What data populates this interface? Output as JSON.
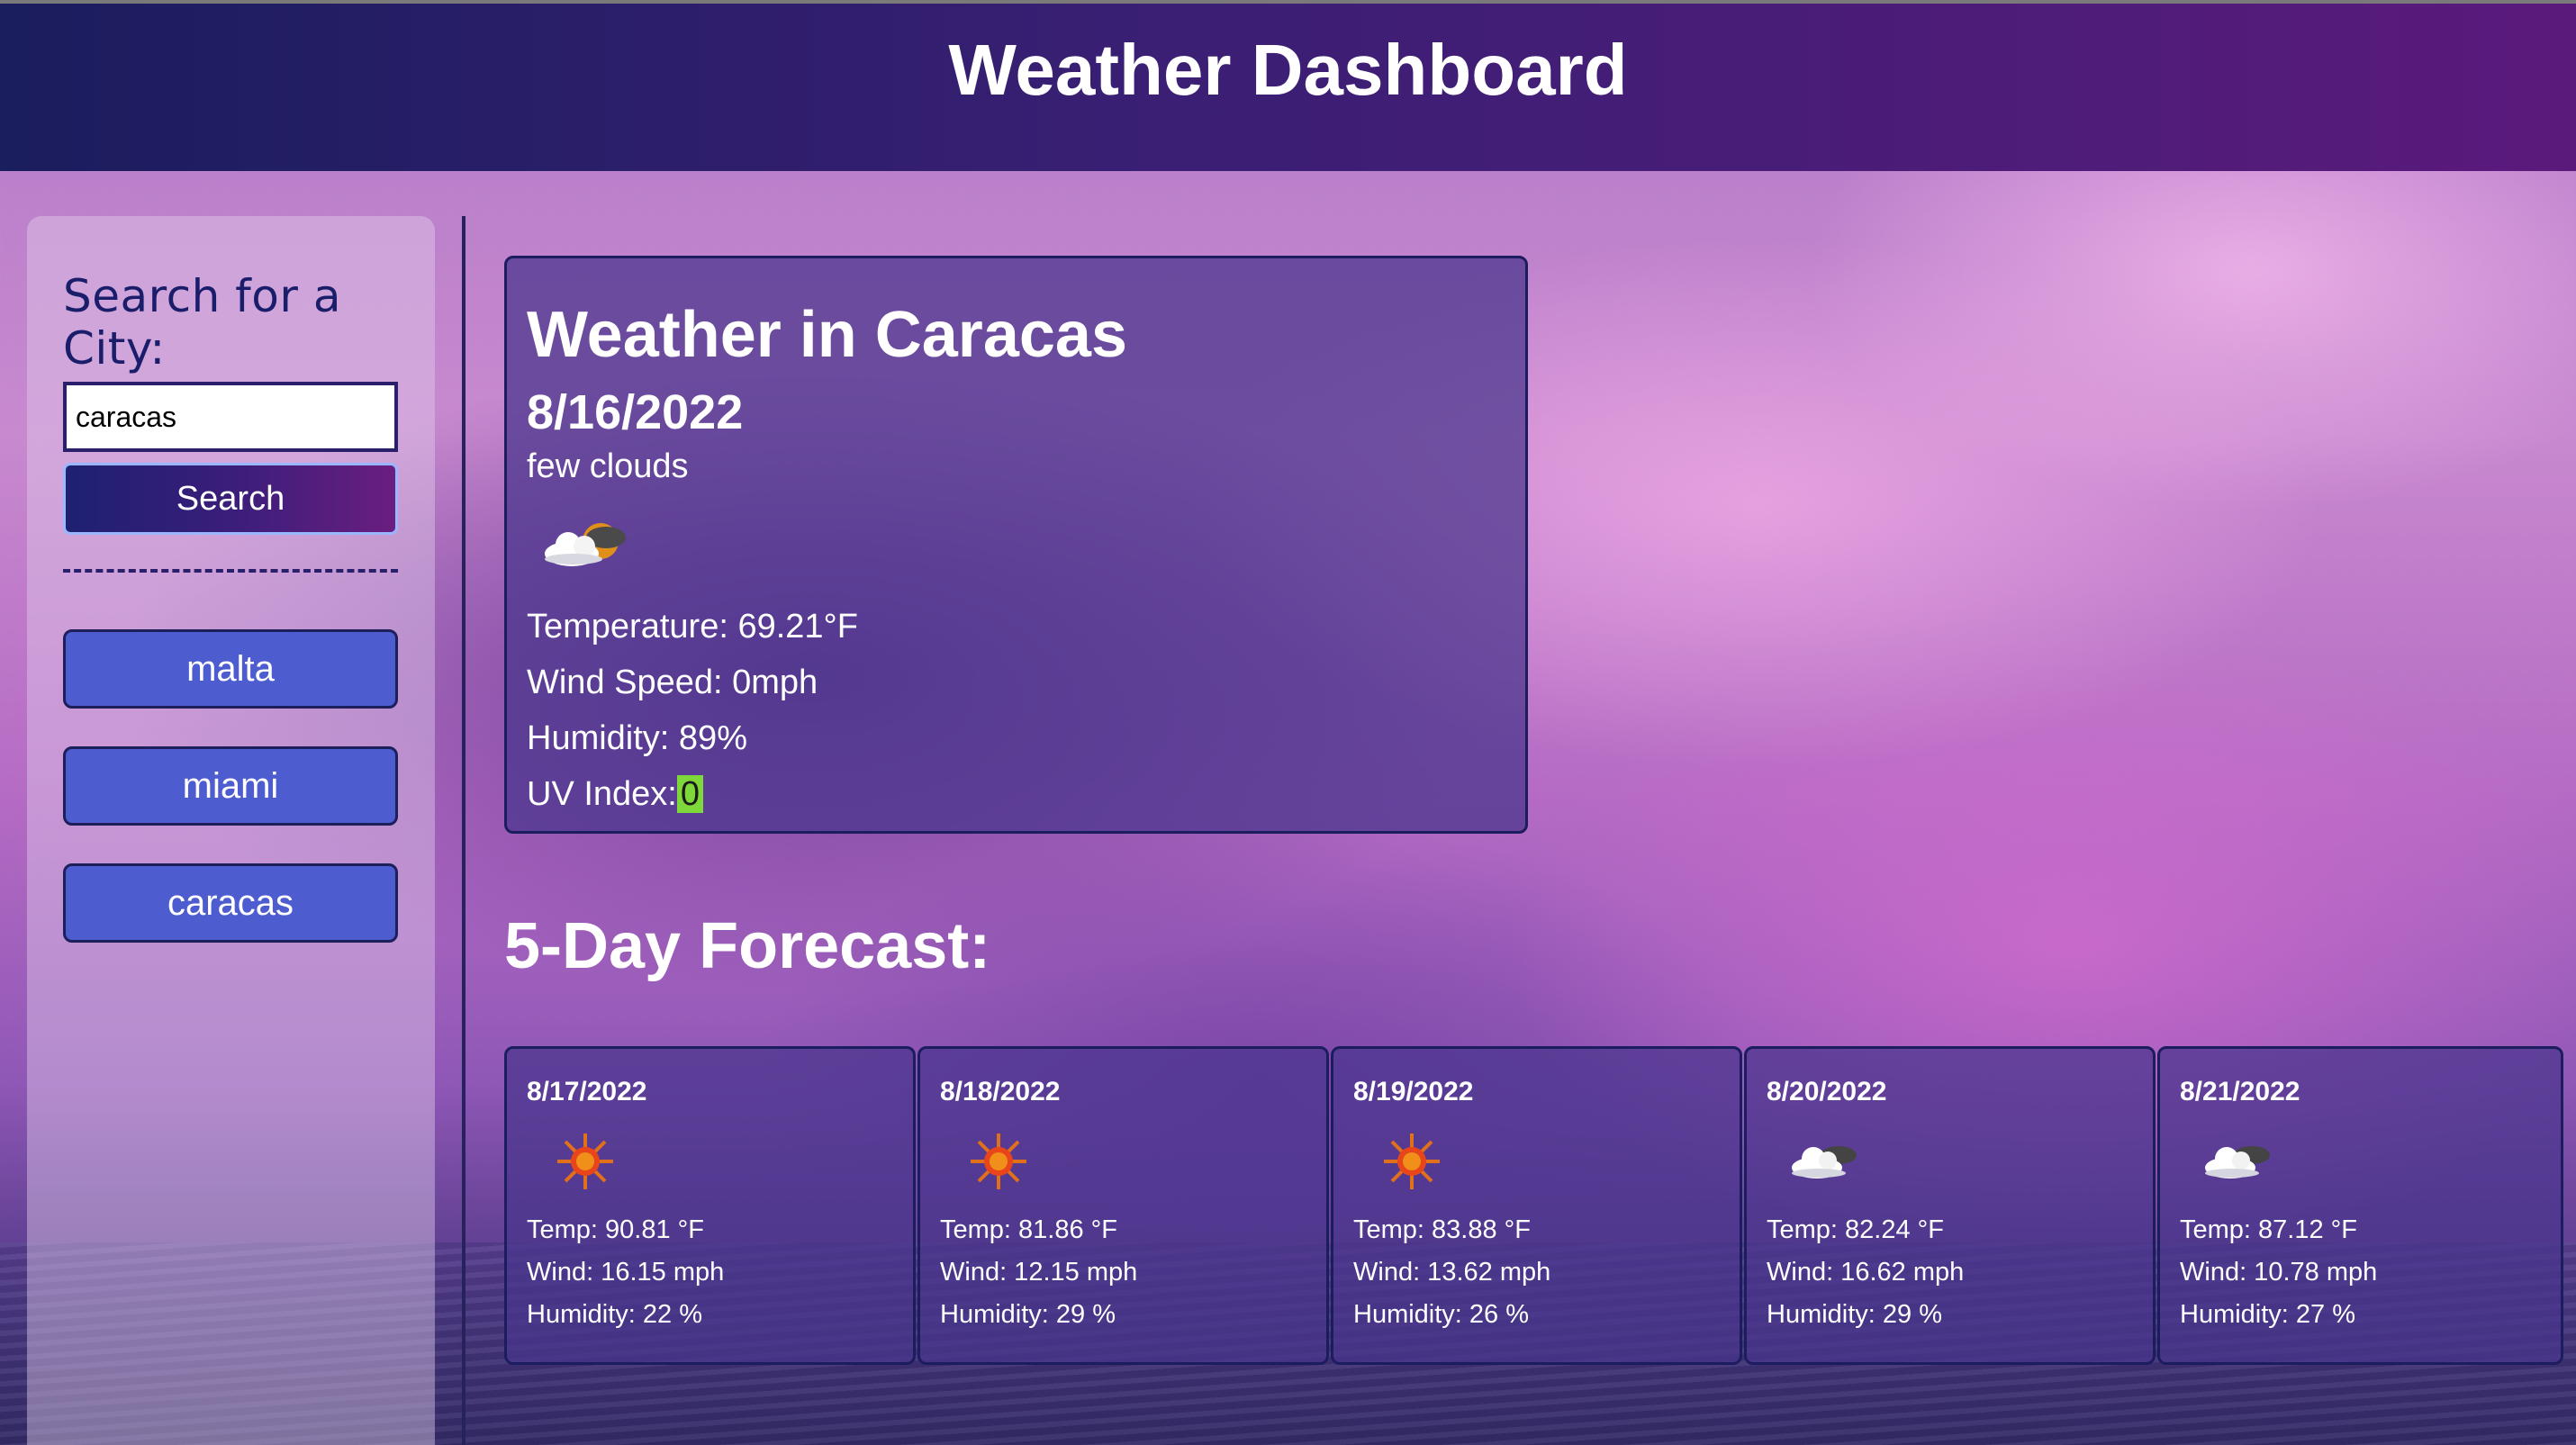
{
  "header": {
    "title": "Weather Dashboard"
  },
  "sidebar": {
    "title": "Search for a City:",
    "search_value": "caracas",
    "search_button": "Search",
    "history": [
      "malta",
      "miami",
      "caracas"
    ]
  },
  "current": {
    "title": "Weather in Caracas",
    "date": "8/16/2022",
    "description": "few clouds",
    "icon": "few-clouds-icon",
    "temperature": "Temperature: 69.21°F",
    "wind": "Wind Speed: 0mph",
    "humidity": "Humidity: 89%",
    "uv_label": "UV Index:",
    "uv_value": "0",
    "uv_color": "#7fd83a"
  },
  "forecast": {
    "title": "5-Day Forecast:",
    "days": [
      {
        "date": "8/17/2022",
        "icon": "sun-icon",
        "temp": "Temp: 90.81 °F",
        "wind": "Wind: 16.15 mph",
        "humidity": "Humidity: 22 %"
      },
      {
        "date": "8/18/2022",
        "icon": "sun-icon",
        "temp": "Temp: 81.86 °F",
        "wind": "Wind: 12.15 mph",
        "humidity": "Humidity: 29 %"
      },
      {
        "date": "8/19/2022",
        "icon": "sun-icon",
        "temp": "Temp: 83.88 °F",
        "wind": "Wind: 13.62 mph",
        "humidity": "Humidity: 26 %"
      },
      {
        "date": "8/20/2022",
        "icon": "clouds-icon",
        "temp": "Temp: 82.24 °F",
        "wind": "Wind: 16.62 mph",
        "humidity": "Humidity: 29 %"
      },
      {
        "date": "8/21/2022",
        "icon": "clouds-icon",
        "temp": "Temp: 87.12 °F",
        "wind": "Wind: 10.78 mph",
        "humidity": "Humidity: 27 %"
      }
    ]
  },
  "colors": {
    "header_start": "#1a1d5e",
    "header_end": "#5a1a7c",
    "history_button": "#4d5ccf",
    "card_background": "#48348c"
  }
}
